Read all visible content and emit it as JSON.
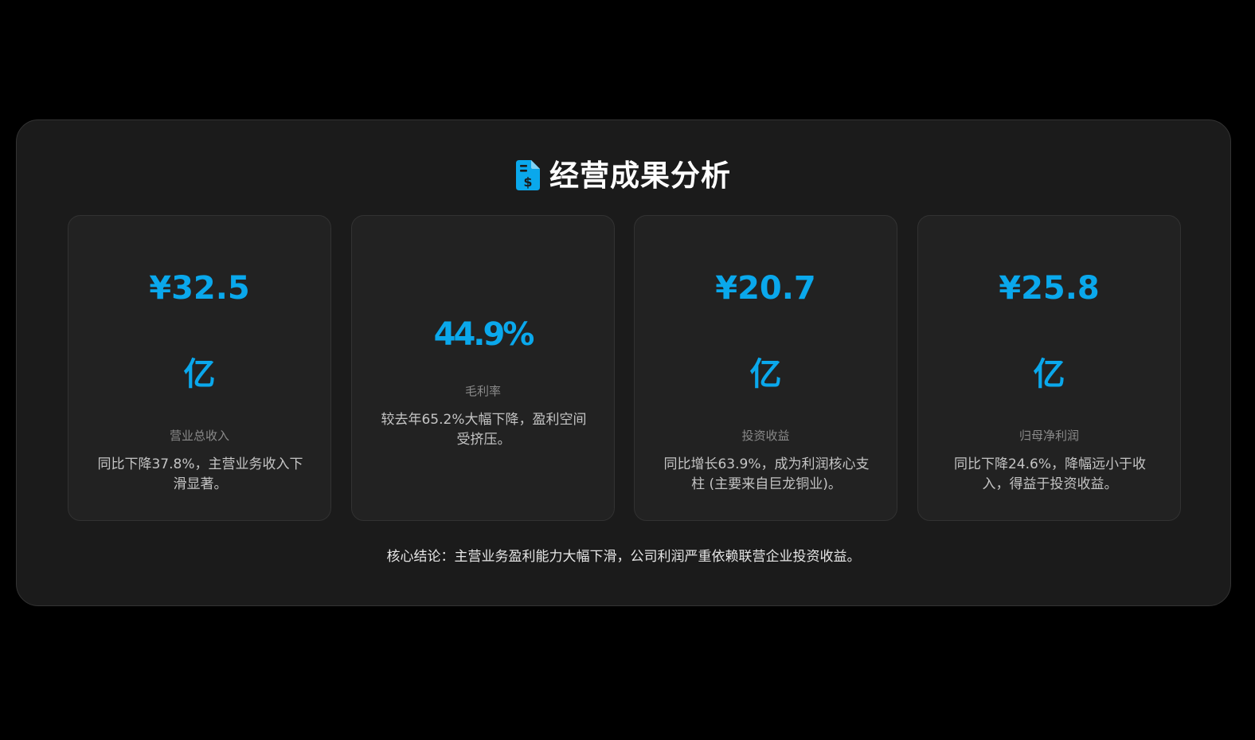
{
  "section": {
    "title": "经营成果分析",
    "icon": "invoice-dollar-icon",
    "accent_color": "#0aa8ec"
  },
  "cards": [
    {
      "value_line1": "¥32.5",
      "value_line2": "亿",
      "label": "营业总收入",
      "description": "同比下降37.8%，主营业务收入下滑显著。"
    },
    {
      "value": "44.9%",
      "label": "毛利率",
      "description": "较去年65.2%大幅下降，盈利空间受挤压。"
    },
    {
      "value_line1": "¥20.7",
      "value_line2": "亿",
      "label": "投资收益",
      "description": "同比增长63.9%，成为利润核心支柱 (主要来自巨龙铜业)。"
    },
    {
      "value_line1": "¥25.8",
      "value_line2": "亿",
      "label": "归母净利润",
      "description": "同比下降24.6%，降幅远小于收入，得益于投资收益。"
    }
  ],
  "conclusion": "核心结论：主营业务盈利能力大幅下滑，公司利润严重依赖联营企业投资收益。"
}
